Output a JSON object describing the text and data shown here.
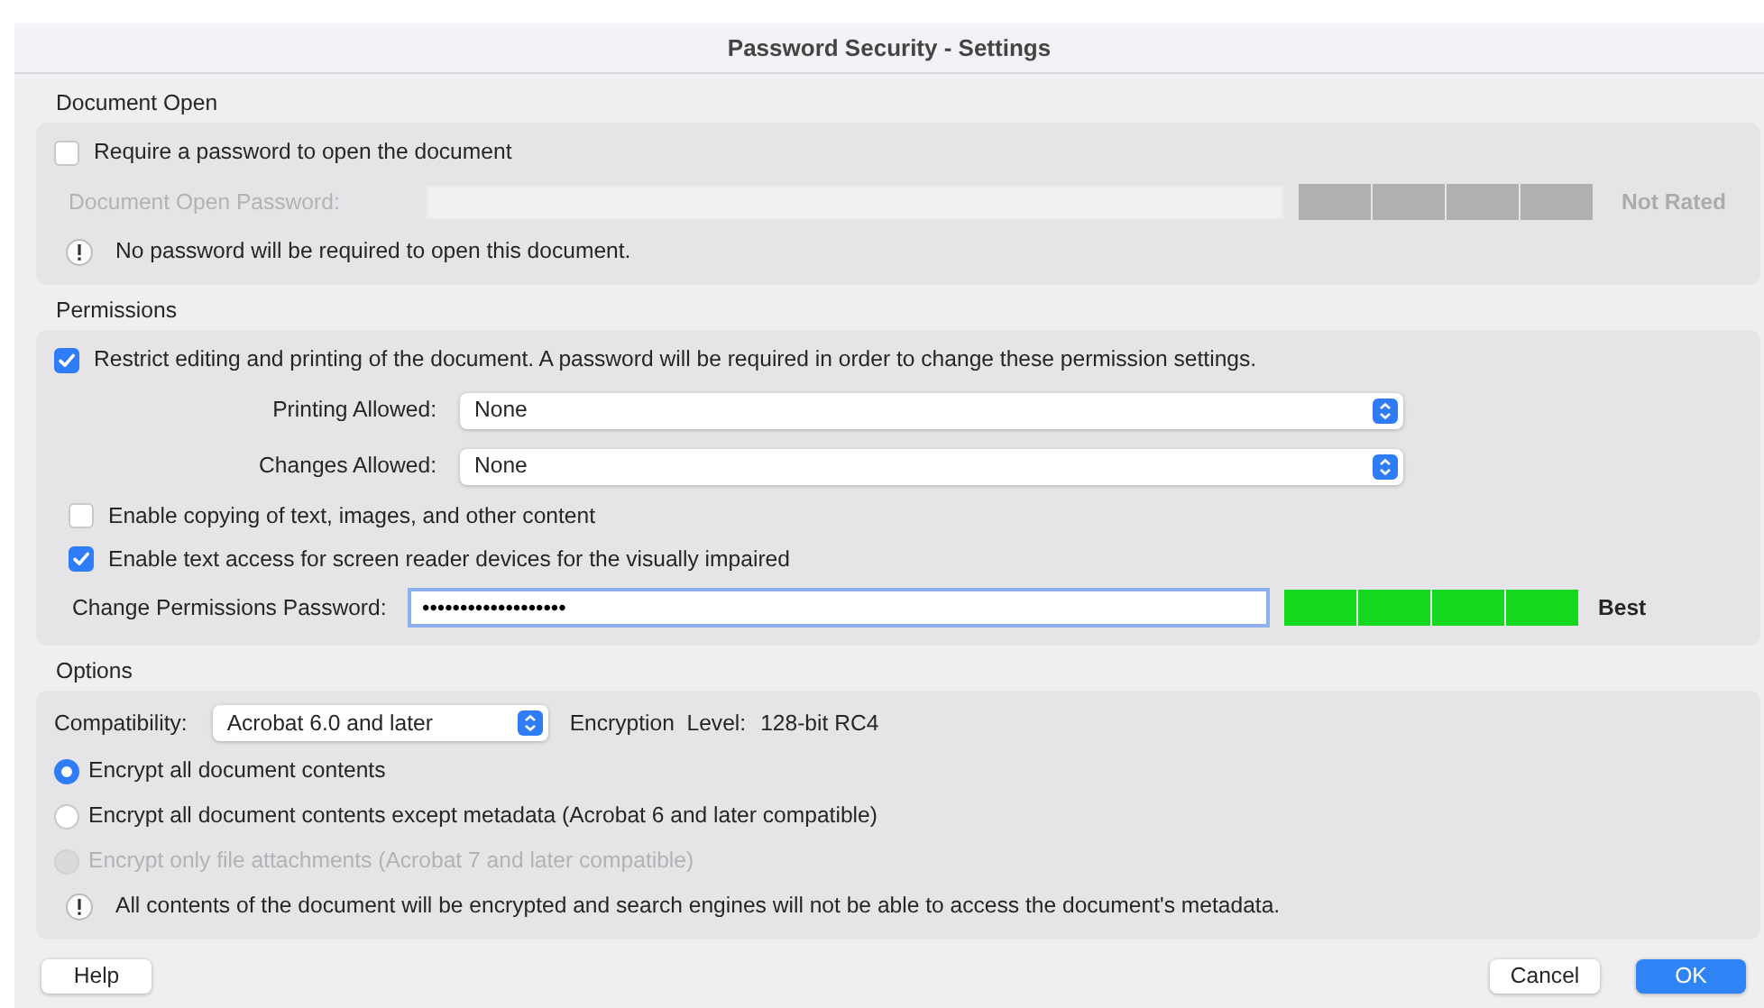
{
  "window": {
    "title": "Password Security - Settings"
  },
  "document_open": {
    "heading": "Document Open",
    "require": {
      "label": "Require a password to open the document",
      "checked": false
    },
    "password": {
      "label": "Document Open Password:",
      "disabled": true,
      "strength": {
        "level": 0,
        "rating": "Not Rated"
      }
    },
    "info": "No password will be required to open this document."
  },
  "permissions": {
    "heading": "Permissions",
    "restrict": {
      "label": "Restrict editing and printing of the document. A password will be required in order to change these permission settings.",
      "checked": true
    },
    "selects": [
      {
        "label": "Printing Allowed:",
        "value": "None"
      },
      {
        "label": "Changes Allowed:",
        "value": "None"
      }
    ],
    "checks": [
      {
        "label": "Enable copying of text, images, and other content",
        "checked": false
      },
      {
        "label": "Enable text access for screen reader devices for the visually impaired",
        "checked": true
      }
    ],
    "password": {
      "label": "Change Permissions Password:",
      "disabled": false,
      "value": "•••••••••••••••••••",
      "strength": {
        "level": 1,
        "rating": "Best"
      }
    }
  },
  "options": {
    "heading": "Options",
    "compatibility": {
      "label": "Compatibility:",
      "value": "Acrobat 6.0 and later"
    },
    "encryption": {
      "label": "Encryption  Level:",
      "value": "128-bit RC4"
    },
    "radios": [
      {
        "label": "Encrypt all document contents",
        "selected": true,
        "disabled": false
      },
      {
        "label": "Encrypt all document contents except metadata (Acrobat 6 and later compatible)",
        "selected": false,
        "disabled": false
      },
      {
        "label": "Encrypt only file attachments (Acrobat 7 and later compatible)",
        "selected": false,
        "disabled": true
      }
    ],
    "info": "All contents of the document will be encrypted and search engines will not be able to access the document's metadata."
  },
  "buttons": [
    {
      "label": "Help",
      "kind": "plain"
    },
    {
      "label": "Cancel",
      "kind": "plain"
    },
    {
      "label": "OK",
      "kind": "default"
    }
  ]
}
